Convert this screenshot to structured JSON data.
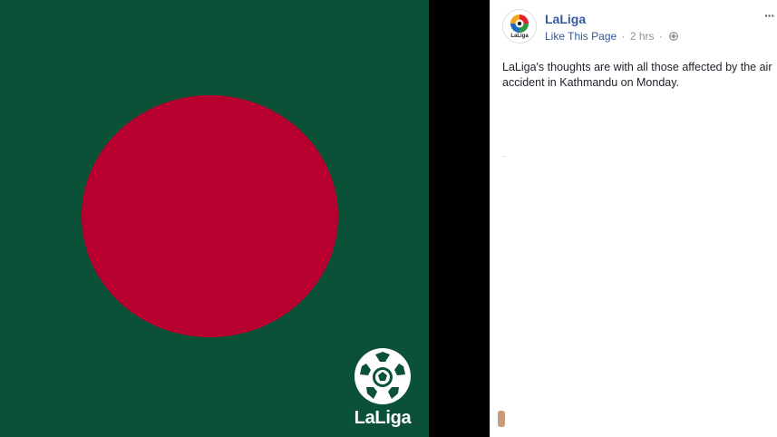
{
  "photo": {
    "field_color": "#0b5137",
    "disc_color": "#b8002e",
    "watermark_text": "LaLiga"
  },
  "post": {
    "page_name": "LaLiga",
    "avatar_label": "LaLiga",
    "like_page_label": "Like This Page",
    "separator": "·",
    "timestamp": "2 hrs",
    "separator2": "·",
    "more_label": "···",
    "message": "LaLiga's thoughts are with all those affected by the air accident in Kathmandu on Monday.",
    "link_color": "#365899",
    "icons": {
      "audience": "globe-icon",
      "options": "more-options-icon",
      "avatar": "laliga-logo-icon",
      "watermark": "laliga-logo-icon"
    }
  }
}
